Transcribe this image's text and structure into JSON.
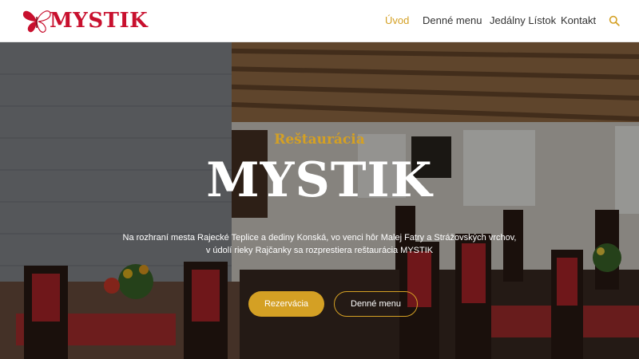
{
  "brand": {
    "name": "MYSTIK",
    "logo_icon": "butterfly-logo-icon"
  },
  "nav": {
    "items": [
      {
        "label": "Úvod",
        "active": true
      },
      {
        "label": "Denné menu",
        "active": false
      },
      {
        "label": "Jedálny Lístok",
        "active": false
      },
      {
        "label": "Kontakt",
        "active": false
      }
    ],
    "search_icon": "search-icon"
  },
  "hero": {
    "subtitle": "Reštaurácia",
    "title": "MYSTIK",
    "description_line1": "Na rozhraní mesta Rajecké Teplice a dediny Konská,  vo venci hôr Malej Fatry a Strážovských vrchov,",
    "description_line2": "v údolí rieky Rajčanky sa rozprestiera reštaurácia MYSTIK",
    "primary_button": "Rezervácia",
    "secondary_button": "Denné menu"
  },
  "colors": {
    "accent": "#d4a024",
    "brand_red": "#c8102e",
    "nav_text": "#333333"
  }
}
